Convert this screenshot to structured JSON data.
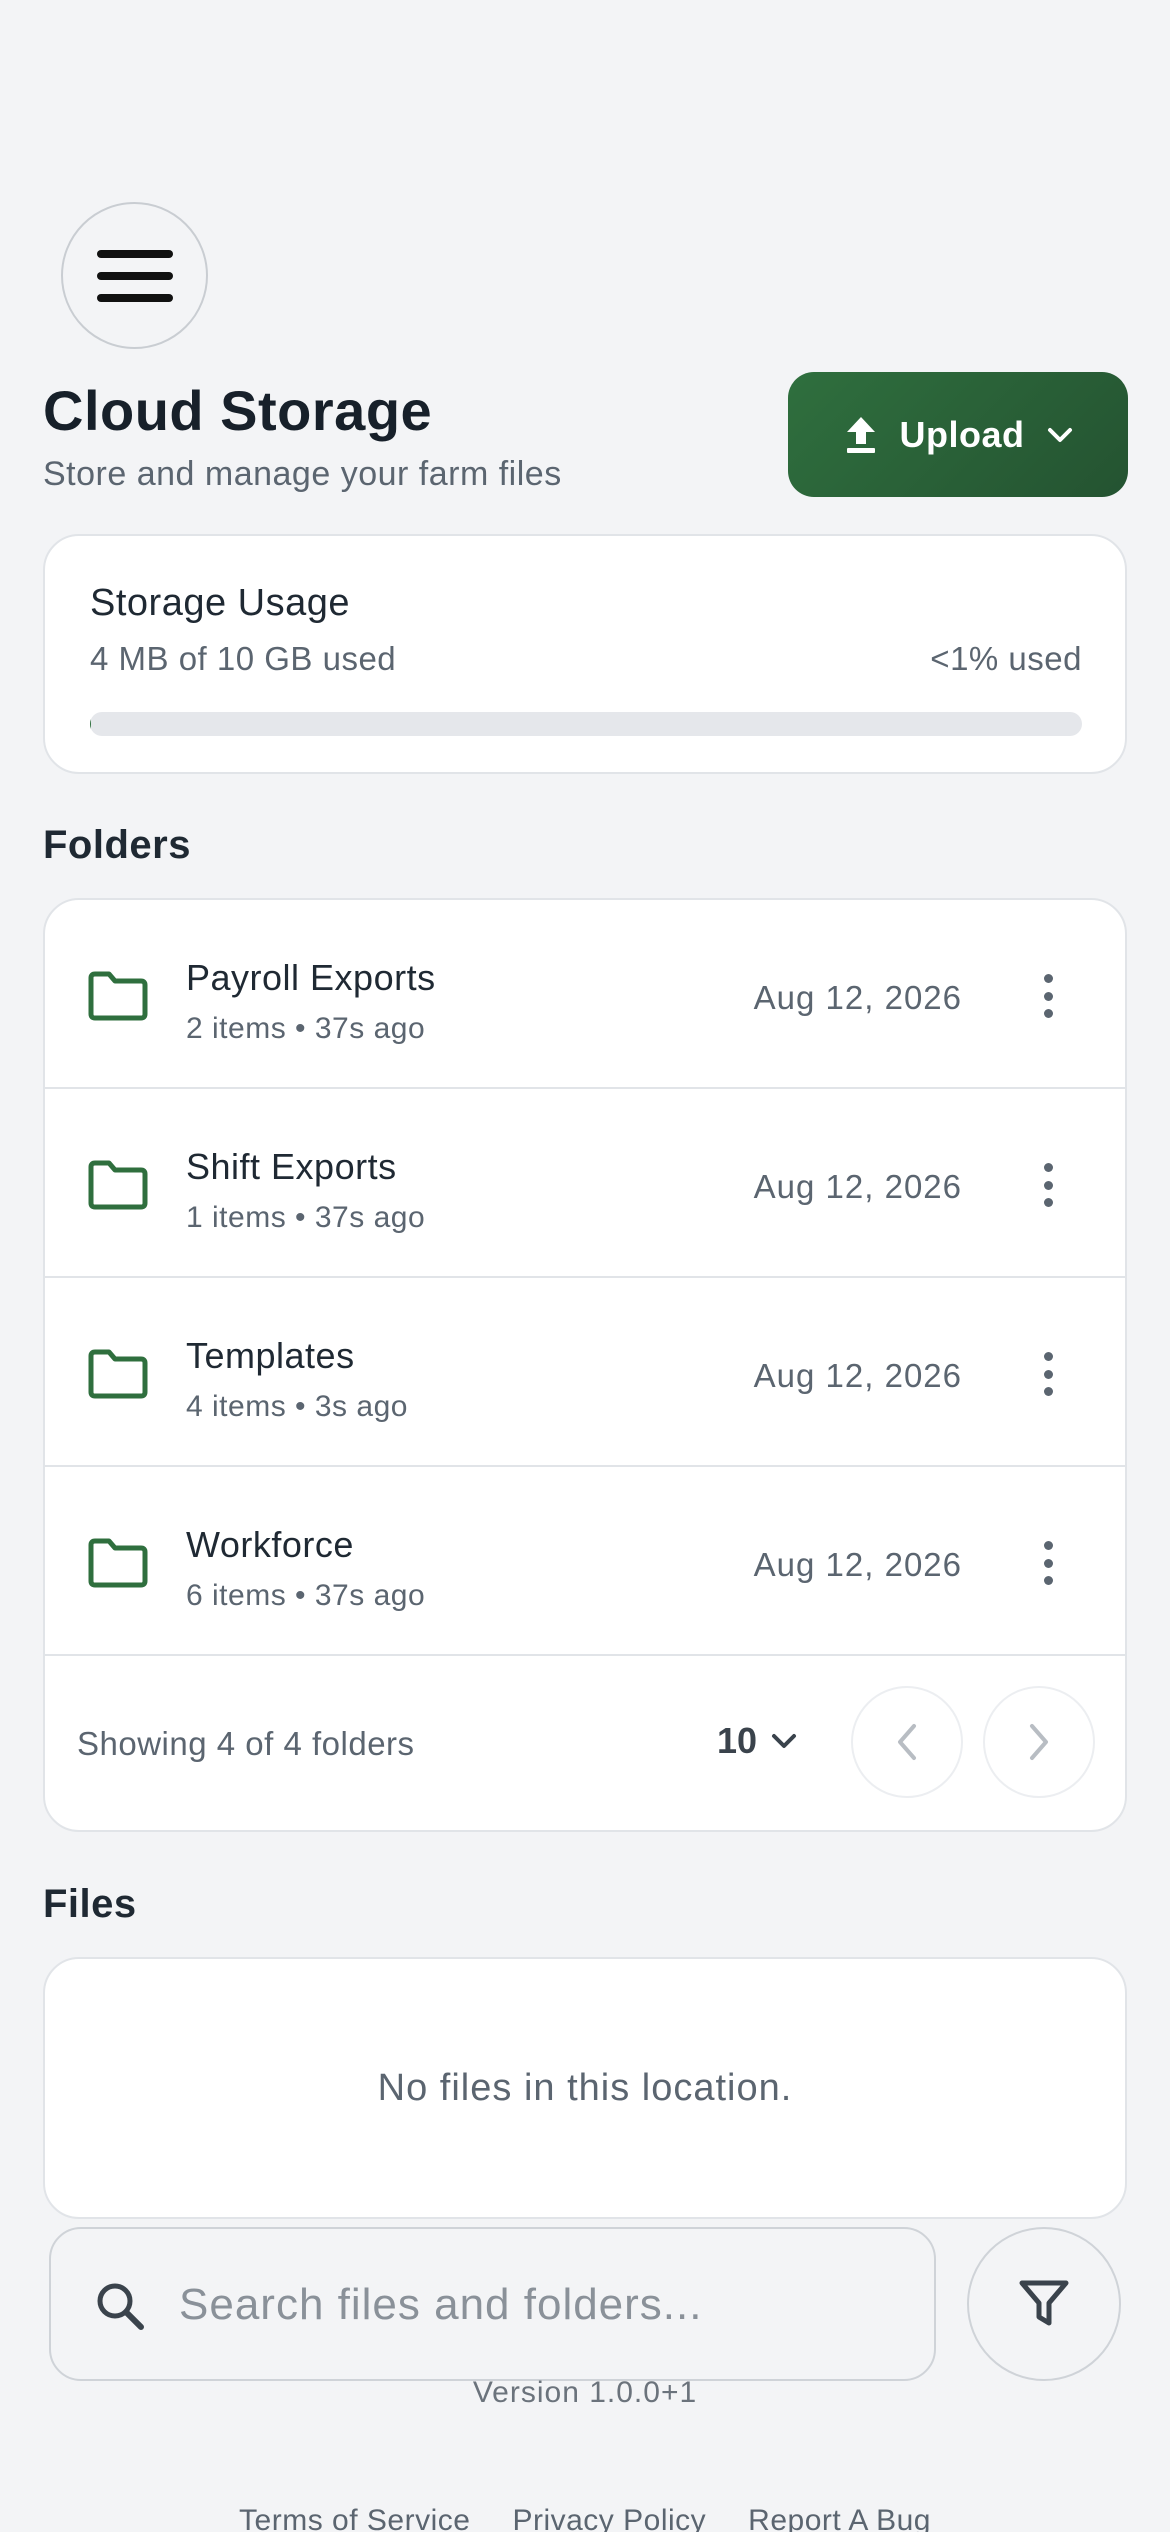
{
  "header": {
    "title": "Cloud Storage",
    "subtitle": "Store and manage your farm files",
    "upload_label": "Upload",
    "menu_icon": "hamburger-menu-icon"
  },
  "colors": {
    "brand_green": "#2f6f3e",
    "background": "#f3f4f6"
  },
  "storage": {
    "title": "Storage Usage",
    "used_text": "4 MB of 10 GB used",
    "percent_text": "<1% used",
    "used_fraction": 0.0004
  },
  "folders": {
    "section_title": "Folders",
    "items": [
      {
        "name": "Payroll Exports",
        "meta": "2 items • 37s ago",
        "date": "Aug 12, 2026"
      },
      {
        "name": "Shift Exports",
        "meta": "1 items • 37s ago",
        "date": "Aug 12, 2026"
      },
      {
        "name": "Templates",
        "meta": "4 items • 3s ago",
        "date": "Aug 12, 2026"
      },
      {
        "name": "Workforce",
        "meta": "6 items • 37s ago",
        "date": "Aug 12, 2026"
      }
    ],
    "showing_text": "Showing 4 of 4 folders",
    "per_page": "10"
  },
  "files": {
    "section_title": "Files",
    "empty_text": "No files in this location."
  },
  "search": {
    "placeholder": "Search files and folders..."
  },
  "footer": {
    "version": "Version 1.0.0+1",
    "links": [
      "Terms of Service",
      "Privacy Policy",
      "Report A Bug"
    ]
  }
}
